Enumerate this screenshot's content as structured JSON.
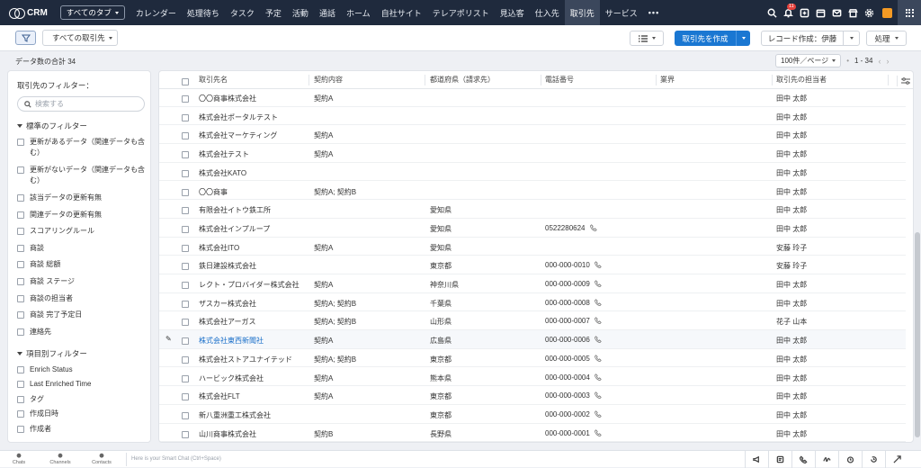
{
  "app": {
    "name": "CRM",
    "tab_select": "すべてのタブ"
  },
  "nav": [
    "カレンダー",
    "処理待ち",
    "タスク",
    "予定",
    "活動",
    "通話",
    "ホーム",
    "自社サイト",
    "テレアポリスト",
    "見込客",
    "仕入先",
    "取引先",
    "サービス",
    "•••"
  ],
  "nav_active": "取引先",
  "top_icons": [
    "search-icon",
    "bell-icon",
    "add-icon",
    "calendar-icon",
    "mail-icon",
    "store-icon",
    "gear-icon"
  ],
  "notification_count": "11",
  "toolbar": {
    "view_select": "すべての取引先",
    "create_label": "取引先を作成",
    "record_label": "レコード作成：伊藤",
    "process_label": "処理"
  },
  "record_count": "データ数の合計 34",
  "pager": {
    "per_page": "100件／ページ",
    "range": "1 - 34"
  },
  "filters": {
    "title": "取引先のフィルター：",
    "search_placeholder": "検索する",
    "standard_title": "標準のフィルター",
    "standard": [
      "更新があるデータ（関連データも含む）",
      "更新がないデータ（関連データも含む）",
      "該当データの更新有無",
      "関連データの更新有無",
      "スコアリングルール",
      "商談",
      "商談 総額",
      "商談 ステージ",
      "商談の担当者",
      "商談 完了予定日",
      "連絡先"
    ],
    "field_title": "項目別フィルター",
    "field": [
      "Enrich Status",
      "Last Enriched Time",
      "タグ",
      "作成日時",
      "作成者"
    ]
  },
  "table": {
    "headers": [
      "取引先名",
      "契約内容",
      "都道府県（請求先）",
      "電話番号",
      "業界",
      "取引先の担当者"
    ],
    "rows": [
      {
        "name": "〇〇商事株式会社",
        "contract": "契約A",
        "pref": "",
        "phone": "",
        "industry": "",
        "owner": "田中 太郎"
      },
      {
        "name": "株式会社ポータルテスト",
        "contract": "",
        "pref": "",
        "phone": "",
        "industry": "",
        "owner": "田中 太郎"
      },
      {
        "name": "株式会社マーケティング",
        "contract": "契約A",
        "pref": "",
        "phone": "",
        "industry": "",
        "owner": "田中 太郎"
      },
      {
        "name": "株式会社テスト",
        "contract": "契約A",
        "pref": "",
        "phone": "",
        "industry": "",
        "owner": "田中 太郎"
      },
      {
        "name": "株式会社KATO",
        "contract": "",
        "pref": "",
        "phone": "",
        "industry": "",
        "owner": "田中 太郎"
      },
      {
        "name": "〇〇商事",
        "contract": "契約A; 契約B",
        "pref": "",
        "phone": "",
        "industry": "",
        "owner": "田中 太郎"
      },
      {
        "name": "有限会社イトウ鉄工所",
        "contract": "",
        "pref": "愛知県",
        "phone": "",
        "industry": "",
        "owner": "田中 太郎"
      },
      {
        "name": "株式会社インプループ",
        "contract": "",
        "pref": "愛知県",
        "phone": "0522280624",
        "industry": "",
        "owner": "田中 太郎"
      },
      {
        "name": "株式会社ITO",
        "contract": "契約A",
        "pref": "愛知県",
        "phone": "",
        "industry": "",
        "owner": "安藤 玲子"
      },
      {
        "name": "鉄日建設株式会社",
        "contract": "",
        "pref": "東京都",
        "phone": "000-000-0010",
        "industry": "",
        "owner": "安藤 玲子"
      },
      {
        "name": "レクト・プロバイダー株式会社",
        "contract": "契約A",
        "pref": "神奈川県",
        "phone": "000-000-0009",
        "industry": "",
        "owner": "田中 太郎"
      },
      {
        "name": "ザスカー株式会社",
        "contract": "契約A; 契約B",
        "pref": "千葉県",
        "phone": "000-000-0008",
        "industry": "",
        "owner": "田中 太郎"
      },
      {
        "name": "株式会社アーガス",
        "contract": "契約A; 契約B",
        "pref": "山形県",
        "phone": "000-000-0007",
        "industry": "",
        "owner": "花子 山本"
      },
      {
        "name": "株式会社東西新聞社",
        "contract": "契約A",
        "pref": "広島県",
        "phone": "000-000-0006",
        "industry": "",
        "owner": "田中 太郎"
      },
      {
        "name": "株式会社ストアユナイテッド",
        "contract": "契約A; 契約B",
        "pref": "東京都",
        "phone": "000-000-0005",
        "industry": "",
        "owner": "田中 太郎"
      },
      {
        "name": "ハービック株式会社",
        "contract": "契約A",
        "pref": "熊本県",
        "phone": "000-000-0004",
        "industry": "",
        "owner": "田中 太郎"
      },
      {
        "name": "株式会社FLT",
        "contract": "契約A",
        "pref": "東京都",
        "phone": "000-000-0003",
        "industry": "",
        "owner": "田中 太郎"
      },
      {
        "name": "新八重洲重工株式会社",
        "contract": "",
        "pref": "東京都",
        "phone": "000-000-0002",
        "industry": "",
        "owner": "田中 太郎"
      },
      {
        "name": "山川商事株式会社",
        "contract": "契約B",
        "pref": "長野県",
        "phone": "000-000-0001",
        "industry": "",
        "owner": "田中 太郎"
      }
    ],
    "hover_row": 13
  },
  "bottom": {
    "items": [
      "Chats",
      "Channels",
      "Contacts"
    ],
    "smart_chat": "Here is your Smart Chat (Ctrl+Space)"
  },
  "colors": {
    "topbar": "#1f2a3d",
    "primary": "#1a77d2",
    "link": "#1a6fc9"
  }
}
